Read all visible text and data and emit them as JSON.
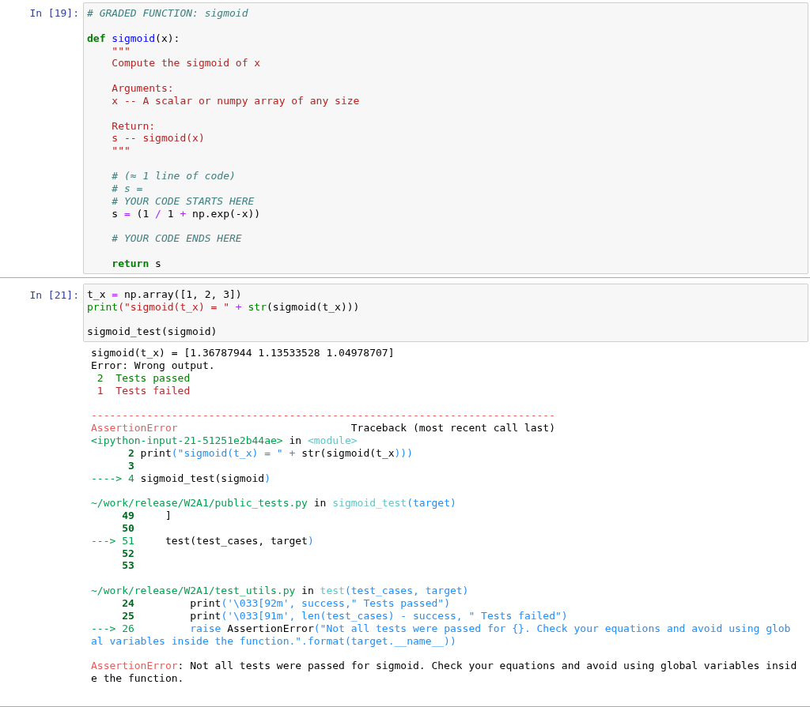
{
  "cells": [
    {
      "prompt": "In [19]:",
      "input": [
        [
          [
            {
              "kind": "comment",
              "text": "# GRADED FUNCTION: sigmoid"
            }
          ]
        ],
        [
          [
            {
              "kind": "kw",
              "text": "def"
            },
            {
              "kind": "def",
              "text": " sigmoid"
            },
            {
              "kind": "plain",
              "text": "(x):"
            }
          ],
          [
            {
              "kind": "str",
              "text": "    \"\"\""
            }
          ],
          [
            {
              "kind": "str",
              "text": "    Compute the sigmoid of x"
            }
          ]
        ],
        [
          [
            {
              "kind": "str",
              "text": "    Arguments:"
            }
          ],
          [
            {
              "kind": "str",
              "text": "    x -- A scalar or numpy array of any size"
            }
          ]
        ],
        [
          [
            {
              "kind": "str",
              "text": "    Return:"
            }
          ],
          [
            {
              "kind": "str",
              "text": "    s -- sigmoid(x)"
            }
          ],
          [
            {
              "kind": "str",
              "text": "    \"\"\""
            }
          ]
        ],
        [
          [
            {
              "kind": "comment",
              "text": "    # (≈ 1 line of code)"
            }
          ],
          [
            {
              "kind": "comment",
              "text": "    # s ="
            }
          ],
          [
            {
              "kind": "comment",
              "text": "    # YOUR CODE STARTS HERE"
            }
          ],
          [
            {
              "kind": "plain",
              "text": "    s"
            },
            {
              "kind": "op",
              "text": " ="
            },
            {
              "kind": "plain",
              "text": " (1"
            },
            {
              "kind": "op",
              "text": " /"
            },
            {
              "kind": "plain",
              "text": " 1"
            },
            {
              "kind": "op",
              "text": " +"
            },
            {
              "kind": "plain",
              "text": " np.exp(-x))"
            }
          ]
        ],
        [
          [
            {
              "kind": "comment",
              "text": "    # YOUR CODE ENDS HERE"
            }
          ]
        ],
        [
          [
            {
              "kind": "kw",
              "text": "    return"
            },
            {
              "kind": "plain",
              "text": " s"
            }
          ]
        ]
      ]
    },
    {
      "prompt": "In [21]:",
      "input": [
        [
          [
            {
              "kind": "plain",
              "text": "t_x"
            },
            {
              "kind": "op",
              "text": " ="
            },
            {
              "kind": "plain",
              "text": " np.array([1, 2, 3])"
            }
          ],
          [
            {
              "kind": "builtin",
              "text": "print"
            },
            {
              "kind": "str",
              "text": "(\"sigmoid(t_x) = \""
            },
            {
              "kind": "op",
              "text": " +"
            },
            {
              "kind": "builtin",
              "text": " str"
            },
            {
              "kind": "plain",
              "text": "(sigmoid(t_x)))"
            }
          ]
        ],
        [
          [
            {
              "kind": "plain",
              "text": "sigmoid_test(sigmoid)"
            }
          ]
        ]
      ],
      "output": [
        [
          [
            {
              "kind": "plain",
              "text": "sigmoid(t_x) = [1.36787944 1.13533528 1.04978707]"
            }
          ],
          [
            {
              "kind": "plain",
              "text": "Error: Wrong output."
            }
          ],
          [
            {
              "kind": "ok",
              "text": " 2  Tests passed"
            }
          ],
          [
            {
              "kind": "fail",
              "text": " 1  Tests failed"
            }
          ]
        ],
        [
          [
            {
              "kind": "ered",
              "text": "---------------------------------------------------------------------------"
            }
          ],
          [
            {
              "kind": "ered",
              "text": "AssertionError"
            },
            {
              "kind": "plain",
              "text": "                            Traceback (most recent call last)"
            }
          ],
          [
            {
              "kind": "egreen",
              "text": "<ipython-input-21-51251e2b44ae>"
            },
            {
              "kind": "plain",
              "text": " in"
            },
            {
              "kind": "ecyan",
              "text": " <module>"
            }
          ],
          [
            {
              "kind": "lnum",
              "text": "      2"
            },
            {
              "kind": "plain",
              "text": " print"
            },
            {
              "kind": "eblue",
              "text": "(\"sigmoid(t_x) = \" +"
            },
            {
              "kind": "plain",
              "text": " str(sigmoid(t_x"
            },
            {
              "kind": "eblue",
              "text": ")))"
            }
          ],
          [
            {
              "kind": "lnum",
              "text": "      3"
            }
          ],
          [
            {
              "kind": "egreen",
              "text": "----> 4"
            },
            {
              "kind": "plain",
              "text": " sigmoid_test(sigmoid"
            },
            {
              "kind": "eblue",
              "text": ")"
            }
          ]
        ],
        [
          [
            {
              "kind": "egreen",
              "text": "~/work/release/W2A1/public_tests.py"
            },
            {
              "kind": "plain",
              "text": " in"
            },
            {
              "kind": "ecyan",
              "text": " sigmoid_test"
            },
            {
              "kind": "eblue",
              "text": "(target)"
            }
          ],
          [
            {
              "kind": "lnum",
              "text": "     49"
            },
            {
              "kind": "plain",
              "text": "     ]"
            }
          ],
          [
            {
              "kind": "lnum",
              "text": "     50"
            }
          ],
          [
            {
              "kind": "egreen",
              "text": "---> 51"
            },
            {
              "kind": "plain",
              "text": "     test(test_cases, target"
            },
            {
              "kind": "eblue",
              "text": ")"
            }
          ],
          [
            {
              "kind": "lnum",
              "text": "     52"
            }
          ],
          [
            {
              "kind": "lnum",
              "text": "     53"
            }
          ]
        ],
        [
          [
            {
              "kind": "egreen",
              "text": "~/work/release/W2A1/test_utils.py"
            },
            {
              "kind": "plain",
              "text": " in"
            },
            {
              "kind": "ecyan",
              "text": " test"
            },
            {
              "kind": "eblue",
              "text": "(test_cases, target)"
            }
          ],
          [
            {
              "kind": "lnum",
              "text": "     24"
            },
            {
              "kind": "plain",
              "text": "         print"
            },
            {
              "kind": "eblue",
              "text": "('\\033[92m', success,\" Tests passed\")"
            }
          ],
          [
            {
              "kind": "lnum",
              "text": "     25"
            },
            {
              "kind": "plain",
              "text": "         print"
            },
            {
              "kind": "eblue",
              "text": "('\\033[91m', len(test_cases) - success, \" Tests failed\")"
            }
          ],
          [
            {
              "kind": "egreen",
              "text": "---> 26"
            },
            {
              "kind": "eblue",
              "text": "         raise"
            },
            {
              "kind": "plain",
              "text": " AssertionError"
            },
            {
              "kind": "eblue",
              "text": "(\"Not all tests were passed for {}. Check your equations and avoid using global variables inside the function.\".format(target.__name__))"
            }
          ]
        ],
        [
          [
            {
              "kind": "ered",
              "text": "AssertionError"
            },
            {
              "kind": "plain",
              "text": ": Not all tests were passed for sigmoid. Check your equations and avoid using global variables inside the function."
            }
          ]
        ]
      ]
    }
  ]
}
